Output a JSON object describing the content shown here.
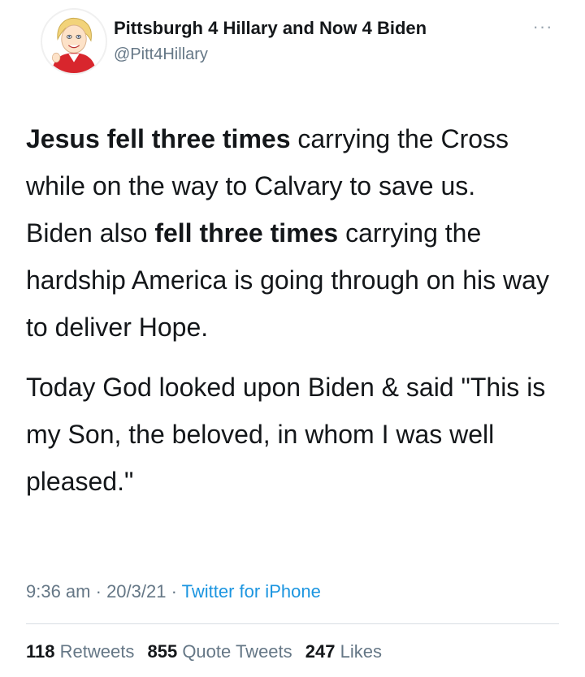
{
  "header": {
    "display_name": "Pittsburgh 4 Hillary and Now 4 Biden",
    "handle": "@Pitt4Hillary",
    "more_icon": "more-options-icon",
    "more_glyph": "···",
    "avatar_icon": "cartoon-avatar-icon"
  },
  "tweet": {
    "p1_bold": "Jesus fell three times",
    "p1_rest": " carrying the Cross while on the way to Calvary to save us.",
    "p2_pre": "Biden also ",
    "p2_bold": "fell three times",
    "p2_rest": " carrying the hardship America is going through on his way to deliver Hope.",
    "p3": "Today God looked upon Biden & said \"This is my Son, the beloved, in whom I was well pleased.\""
  },
  "meta": {
    "time": "9:36 am",
    "sep1": " · ",
    "date": "20/3/21",
    "sep2": " · ",
    "source": "Twitter for iPhone"
  },
  "stats": {
    "retweets_count": "118",
    "retweets_label": "Retweets",
    "quotes_count": "855",
    "quotes_label": "Quote Tweets",
    "likes_count": "247",
    "likes_label": "Likes"
  },
  "colors": {
    "text": "#14171a",
    "secondary": "#657786",
    "link": "#1b95e0",
    "divider": "#d8dee3"
  }
}
